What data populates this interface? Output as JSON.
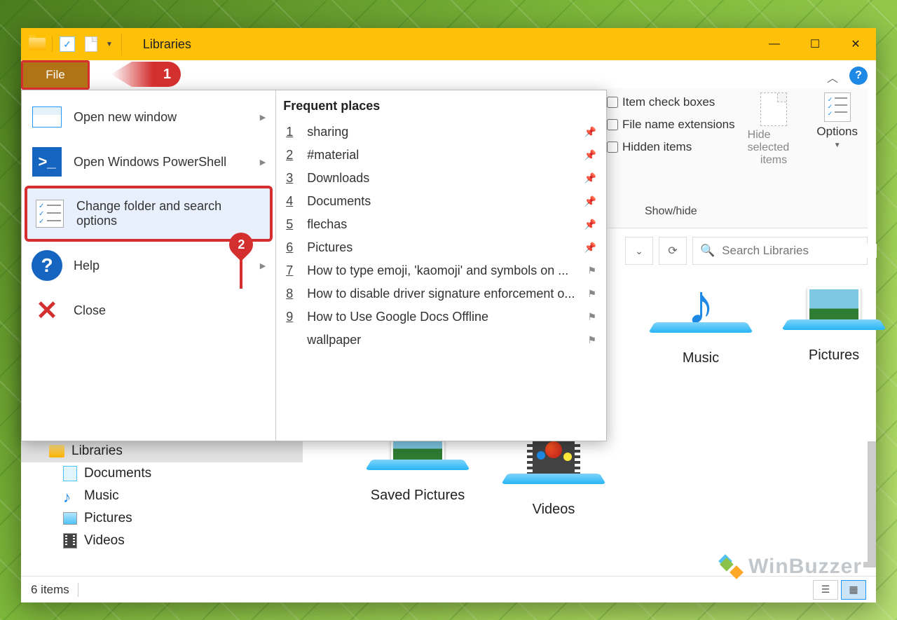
{
  "titlebar": {
    "title": "Libraries"
  },
  "file_tab": "File",
  "callouts": {
    "one": "1",
    "two": "2"
  },
  "file_menu": {
    "open_window": "Open new window",
    "open_ps": "Open Windows PowerShell",
    "change_options": "Change folder and search options",
    "help": "Help",
    "close": "Close",
    "frequent_header": "Frequent places",
    "places": [
      {
        "n": "1",
        "label": "sharing",
        "pinned": true
      },
      {
        "n": "2",
        "label": "#material",
        "pinned": true
      },
      {
        "n": "3",
        "label": "Downloads",
        "pinned": true
      },
      {
        "n": "4",
        "label": "Documents",
        "pinned": true
      },
      {
        "n": "5",
        "label": "flechas",
        "pinned": true
      },
      {
        "n": "6",
        "label": "Pictures",
        "pinned": true
      },
      {
        "n": "7",
        "label": "How to type emoji, 'kaomoji' and symbols on ...",
        "pinned": false
      },
      {
        "n": "8",
        "label": "How to disable driver signature enforcement o...",
        "pinned": false
      },
      {
        "n": "9",
        "label": "How to Use Google Docs Offline",
        "pinned": false
      },
      {
        "n": "",
        "label": "wallpaper",
        "pinned": false
      }
    ]
  },
  "ribbon": {
    "check_item": "Item check boxes",
    "check_ext": "File name extensions",
    "check_hidden": "Hidden items",
    "group": "Show/hide",
    "hide_selected_1": "Hide selected",
    "hide_selected_2": "items",
    "options": "Options"
  },
  "search": {
    "placeholder": "Search Libraries"
  },
  "sidebar": {
    "libraries": "Libraries",
    "documents": "Documents",
    "music": "Music",
    "pictures": "Pictures",
    "videos": "Videos"
  },
  "content": {
    "music": "Music",
    "pictures": "Pictures",
    "saved_pictures": "Saved Pictures",
    "videos": "Videos"
  },
  "status": {
    "items": "6 items"
  },
  "watermark": "WinBuzzer"
}
